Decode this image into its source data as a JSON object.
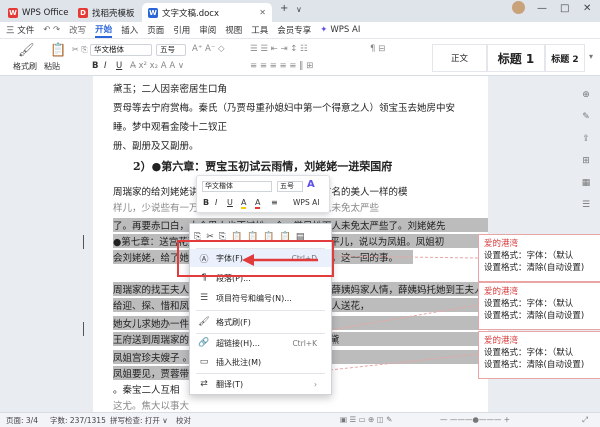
{
  "titlebar": {
    "tabs": [
      {
        "label": "WPS Office",
        "icon": "wps-logo-icon",
        "color": "#e53935"
      },
      {
        "label": "找稻壳模板",
        "icon": "docer-icon",
        "color": "#e53935"
      },
      {
        "label": "文字文稿.docx",
        "icon": "doc-w-icon",
        "color": "#2b66d9"
      }
    ],
    "new_tab": "+",
    "dropdown": "∨",
    "minimize": "—",
    "maximize": "□",
    "close": "✕"
  },
  "menu": {
    "file": "三 文件",
    "undo_redo": "↶ ↷",
    "more": "改写",
    "tabs": [
      "开始",
      "插入",
      "页面",
      "引用",
      "审阅",
      "视图",
      "工具",
      "会员专享"
    ],
    "ai": "WPS AI",
    "active_tab": "开始"
  },
  "toolbar": {
    "format_brush": "格式刷",
    "paste": "粘贴",
    "font_name": "华文楷体",
    "font_size": "五号",
    "bold": "B",
    "italic": "I",
    "underline": "U",
    "style_normal": "正文",
    "style_h1": "标题 1",
    "style_h2": "标题 2"
  },
  "document": {
    "lines": [
      {
        "text": "黛玉；二人因亲密居生口角",
        "sel": false
      },
      {
        "text": "    贾母等去宁府赏梅。秦氏（乃贾母重孙媳妇中第一个得意之人）领宝玉去她房中安",
        "sel": false
      },
      {
        "text": "睡。梦中观看金陵十二钗正",
        "sel": false
      },
      {
        "text": "    册、副册及又副册。",
        "sel": false
      }
    ],
    "heading": "2）●第六章：贾宝玉初试云雨情，刘姥姥一进荣国府",
    "body_lines": [
      {
        "text": "    周瑞家的给刘姥姥讲了凤姐，凤姐乃是贾府中一位有名的美人一样的模",
        "sel": false,
        "faint": false
      },
      {
        "text": "样儿，少说些有一万个心眼子，只是有一件，待下人未免太严些",
        "sel": false,
        "faint": true
      },
      {
        "text": "了。再要赤口白，十个男人也不过她一个，举目她下人未免太严些了。刘姥姥先",
        "sel": true,
        "faint": false
      },
      {
        "text": "●第七章：送宫花贾琏戏熙凤，宴宁府宝玉会秦钟。平儿，说以为凤姐。凤姐初",
        "sel": true,
        "faint": false
      },
      {
        "text": "会刘姥姥，给了她二十两银子，刘姥姥得了钱便告辞。这一回的事。",
        "sel": true,
        "faint": false
      },
      {
        "text": "",
        "sel": false,
        "faint": false
      },
      {
        "text": "    周瑞家的找王夫人回话，王夫人正在薛姨妈处，便去薛姨妈家人情，薛姨妈托她到王夫人处",
        "sel": true,
        "faint": false
      },
      {
        "text": "给迎、探、惜和凤姐各送宫花两枝。周瑞家的去给各人送花，",
        "sel": true,
        "faint": false
      },
      {
        "text": "    她女儿求她办一件事。",
        "sel": true,
        "faint": false
      },
      {
        "text": "王府送到周瑞家的。                   （宫司）；给黛玉送宫制假花，黛",
        "sel": true,
        "faint": false
      },
      {
        "text": "    凤姐宫珍夫嫂子                   。秦氏向宝玉介绍她弟弟秦钟，",
        "sel": true,
        "faint": false
      },
      {
        "text": "凤姐要见，贾蓉带来。",
        "sel": true,
        "faint": false
      },
      {
        "text": "    。秦宝二人互相                   ",
        "sel": false,
        "faint": false
      },
      {
        "text": "    这尤。焦大以事大",
        "sel": false,
        "faint": true
      }
    ]
  },
  "comments": [
    {
      "author": "爱的港湾",
      "line1": "设置格式：字体：（默认",
      "line2": "设置格式：清除(自动设置)"
    },
    {
      "author": "爱的港湾",
      "line1": "设置格式：字体：（默认",
      "line2": "设置格式：清除(自动设置)"
    },
    {
      "author": "爱的港湾",
      "line1": "设置格式：字体：（默认",
      "line2": "设置格式：清除(自动设置)"
    }
  ],
  "mini_toolbar": {
    "font_name": "华文楷体",
    "font_size": "五号",
    "grow": "A⁺",
    "shrink": "A⁻",
    "bold": "B",
    "italic": "I",
    "underline": "U",
    "highlight": "A",
    "font_color": "A",
    "align": "≡",
    "ai": "WPS AI"
  },
  "context_menu": {
    "items": [
      {
        "icon": "font-icon",
        "glyph": "Ⓐ",
        "label": "字体(F)...",
        "shortcut": "Ctrl+D"
      },
      {
        "icon": "paragraph-icon",
        "glyph": "¶",
        "label": "段落(P)...",
        "shortcut": ""
      },
      {
        "icon": "bullets-icon",
        "glyph": "☰",
        "label": "项目符号和编号(N)...",
        "shortcut": ""
      },
      {
        "icon": "format-brush-icon",
        "glyph": "🖌",
        "label": "格式刷(F)",
        "shortcut": ""
      },
      {
        "icon": "link-icon",
        "glyph": "🔗",
        "label": "超链接(H)...",
        "shortcut": "Ctrl+K"
      },
      {
        "icon": "comment-icon",
        "glyph": "▭",
        "label": "插入批注(M)",
        "shortcut": ""
      },
      {
        "icon": "translate-icon",
        "glyph": "⇄",
        "label": "翻译(T)",
        "shortcut": "›"
      }
    ]
  },
  "status": {
    "page": "页面: 3/4",
    "words": "字数: 237/1315",
    "spell": "拼写检查: 打开 ∨",
    "proof": "校对"
  }
}
